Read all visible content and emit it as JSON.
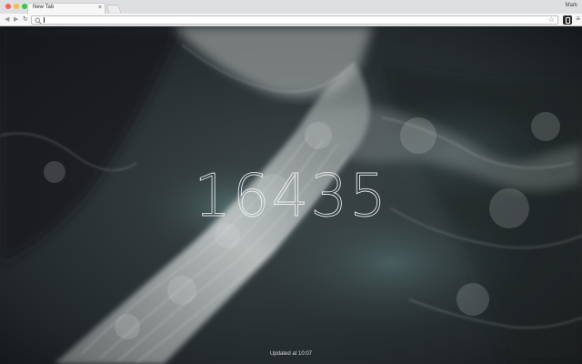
{
  "window": {
    "tab_title": "New Tab",
    "tab_close": "×",
    "profile_name": "Mark"
  },
  "toolbar": {
    "back_icon": "arrow-left-icon",
    "forward_icon": "arrow-right-icon",
    "reload_icon": "reload-icon",
    "address_value": "",
    "bookmark_icon": "star-icon",
    "extension_icon": "extension-icon",
    "menu_icon": "menu-icon"
  },
  "page": {
    "counter": "16435",
    "updated_text": "Updated at 10:07"
  },
  "colors": {
    "tabstrip": "#dedfe1",
    "toolbar": "#f6f6f6",
    "ocean_dark": "#1c2023",
    "foam": "#c9cdcd",
    "water_teal": "#4d6a6a"
  }
}
